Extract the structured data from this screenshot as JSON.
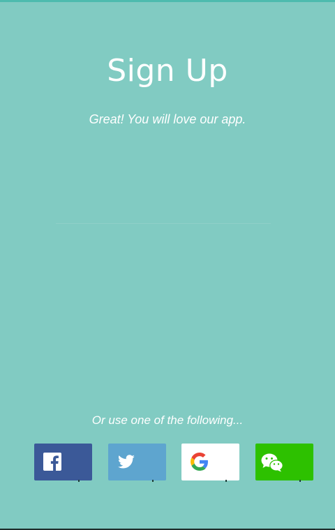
{
  "header": {
    "title": "Sign Up",
    "subtitle": "Great! You will love our app."
  },
  "social": {
    "prompt": "Or use one of the following...",
    "buttons": [
      {
        "name": "facebook",
        "icon": "facebook-icon",
        "color": "#3b5998"
      },
      {
        "name": "twitter",
        "icon": "twitter-icon",
        "color": "#5ea5cf"
      },
      {
        "name": "google",
        "icon": "google-icon",
        "color": "#ffffff"
      },
      {
        "name": "wechat",
        "icon": "wechat-icon",
        "color": "#2dc100"
      }
    ]
  },
  "colors": {
    "background": "#81cbc2",
    "text": "#ffffff"
  }
}
